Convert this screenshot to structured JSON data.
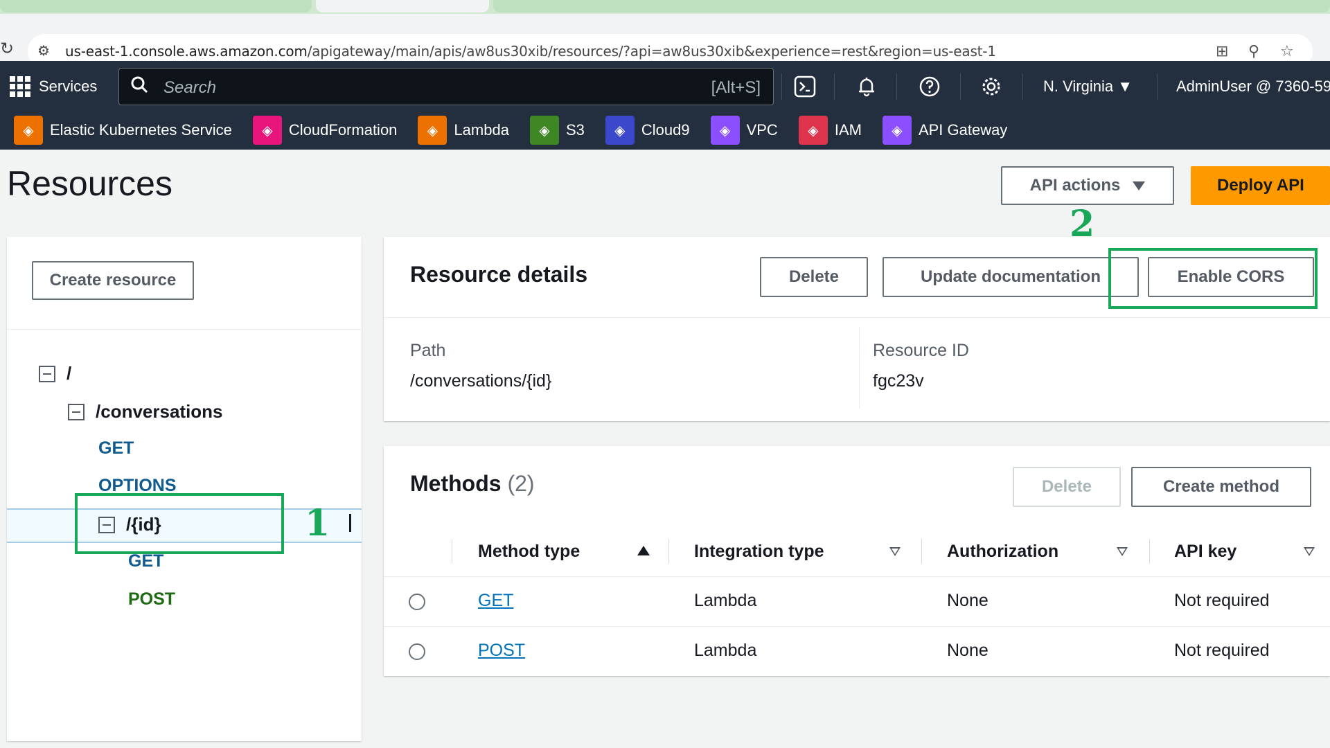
{
  "browser": {
    "url_host": "us-east-1.console.aws.amazon.com",
    "url_rest": "/apigateway/main/apis/aw8us30xib/resources/?api=aw8us30xib&experience=rest&region=us-east-1"
  },
  "nav": {
    "services_label": "Services",
    "search_placeholder": "Search",
    "search_shortcut": "[Alt+S]",
    "region": "N. Virginia",
    "user": "AdminUser @ 7360-59"
  },
  "favorites": [
    {
      "label": "Elastic Kubernetes Service",
      "color": "#ed7100",
      "icon": "eks-icon"
    },
    {
      "label": "CloudFormation",
      "color": "#e7157b",
      "icon": "cloudformation-icon"
    },
    {
      "label": "Lambda",
      "color": "#ed7100",
      "icon": "lambda-icon"
    },
    {
      "label": "S3",
      "color": "#3f8624",
      "icon": "s3-icon"
    },
    {
      "label": "Cloud9",
      "color": "#3b48cc",
      "icon": "cloud9-icon"
    },
    {
      "label": "VPC",
      "color": "#8c4fff",
      "icon": "vpc-icon"
    },
    {
      "label": "IAM",
      "color": "#dd344c",
      "icon": "iam-icon"
    },
    {
      "label": "API Gateway",
      "color": "#8c4fff",
      "icon": "api-gateway-icon"
    }
  ],
  "page": {
    "title": "Resources",
    "api_actions_label": "API actions",
    "deploy_label": "Deploy API"
  },
  "tree": {
    "create_resource_label": "Create resource",
    "root": "/",
    "conversations": "/conversations",
    "conv_get": "GET",
    "conv_options": "OPTIONS",
    "id_path": "/{id}",
    "id_get": "GET",
    "id_post": "POST"
  },
  "annotations": {
    "one": "1",
    "two": "2"
  },
  "details": {
    "title": "Resource details",
    "delete_label": "Delete",
    "update_doc_label": "Update documentation",
    "enable_cors_label": "Enable CORS",
    "path_label": "Path",
    "path_value": "/conversations/{id}",
    "id_label": "Resource ID",
    "id_value": "fgc23v"
  },
  "methods": {
    "title": "Methods",
    "count": "(2)",
    "delete_label": "Delete",
    "create_label": "Create method",
    "columns": [
      "Method type",
      "Integration type",
      "Authorization",
      "API key"
    ],
    "rows": [
      {
        "method": "GET",
        "integration": "Lambda",
        "auth": "None",
        "apikey": "Not required"
      },
      {
        "method": "POST",
        "integration": "Lambda",
        "auth": "None",
        "apikey": "Not required"
      }
    ]
  },
  "colors": {
    "nav_bg": "#232f3e",
    "primary": "#ff9900",
    "annotation": "#19a85a",
    "link": "#0073bb"
  }
}
